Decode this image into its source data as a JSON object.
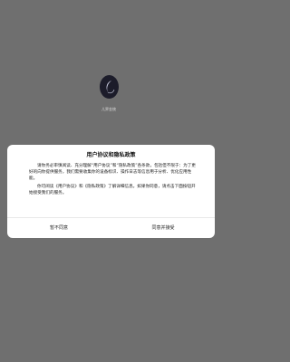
{
  "app": {
    "icon": "app-logo-icon",
    "name": "儿界金统"
  },
  "dialog": {
    "title": "用户协议和隐私政策",
    "body": [
      "请你务必审慎阅读、充分理解“用户协议”和“隐私政策”各条款，包括但不限于：为了更好的向你提供服务，我们需要收集你的设备标识、操作日志等信息用于分析、优化应用性能。",
      "你可阅读《用户协议》和《隐私政策》了解详细信息。如果你同意，请点击下面按钮开始接受我们的服务。"
    ],
    "disagree_label": "暂不同意",
    "agree_label": "同意并接受"
  },
  "colors": {
    "overlay": "#6f6f6f",
    "dialog_bg": "#ffffff"
  }
}
